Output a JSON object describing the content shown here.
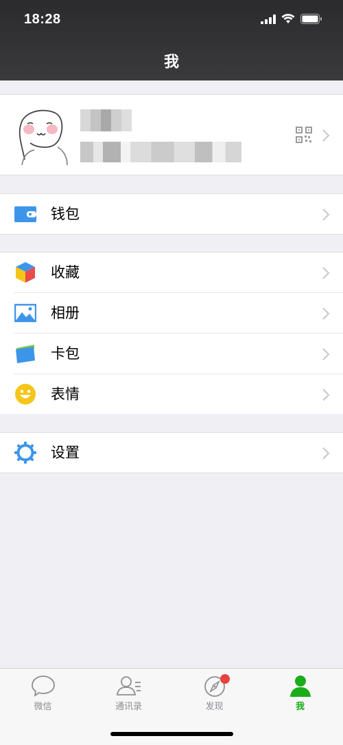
{
  "status_bar": {
    "time": "18:28"
  },
  "nav": {
    "title": "我"
  },
  "profile": {},
  "wallet_section": [
    {
      "label": "钱包",
      "icon": "wallet-icon"
    }
  ],
  "menu_section": [
    {
      "label": "收藏",
      "icon": "favorites-icon"
    },
    {
      "label": "相册",
      "icon": "album-icon"
    },
    {
      "label": "卡包",
      "icon": "card-pack-icon"
    },
    {
      "label": "表情",
      "icon": "sticker-icon"
    }
  ],
  "settings_section": [
    {
      "label": "设置",
      "icon": "settings-gear-icon"
    }
  ],
  "tabbar": {
    "tabs": [
      {
        "label": "微信",
        "icon": "chat-bubble-icon",
        "active": false
      },
      {
        "label": "通讯录",
        "icon": "contacts-icon",
        "active": false
      },
      {
        "label": "发现",
        "icon": "compass-icon",
        "active": false,
        "badge": true
      },
      {
        "label": "我",
        "icon": "person-icon",
        "active": true
      }
    ]
  },
  "colors": {
    "accent_green": "#1aad19",
    "badge_red": "#e64340",
    "nav_bg": "#2e2e30",
    "page_bg": "#efeff4"
  }
}
